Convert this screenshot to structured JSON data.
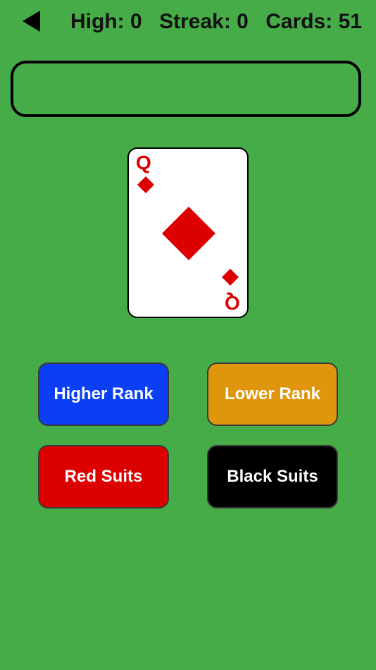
{
  "header": {
    "high": "High: 0",
    "streak": "Streak: 0",
    "cards": "Cards: 51"
  },
  "message": "",
  "card": {
    "rank": "Q",
    "suit": "diamonds",
    "color": "#dd0000"
  },
  "buttons": {
    "higher": {
      "label": "Higher Rank",
      "color": "#0a3ff5"
    },
    "lower": {
      "label": "Lower Rank",
      "color": "#e0960c"
    },
    "red": {
      "label": "Red Suits",
      "color": "#dd0000"
    },
    "black": {
      "label": "Black Suits",
      "color": "#000000"
    }
  },
  "colors": {
    "table": "#46ac48"
  },
  "icons": {
    "back": "back-arrow-icon"
  }
}
